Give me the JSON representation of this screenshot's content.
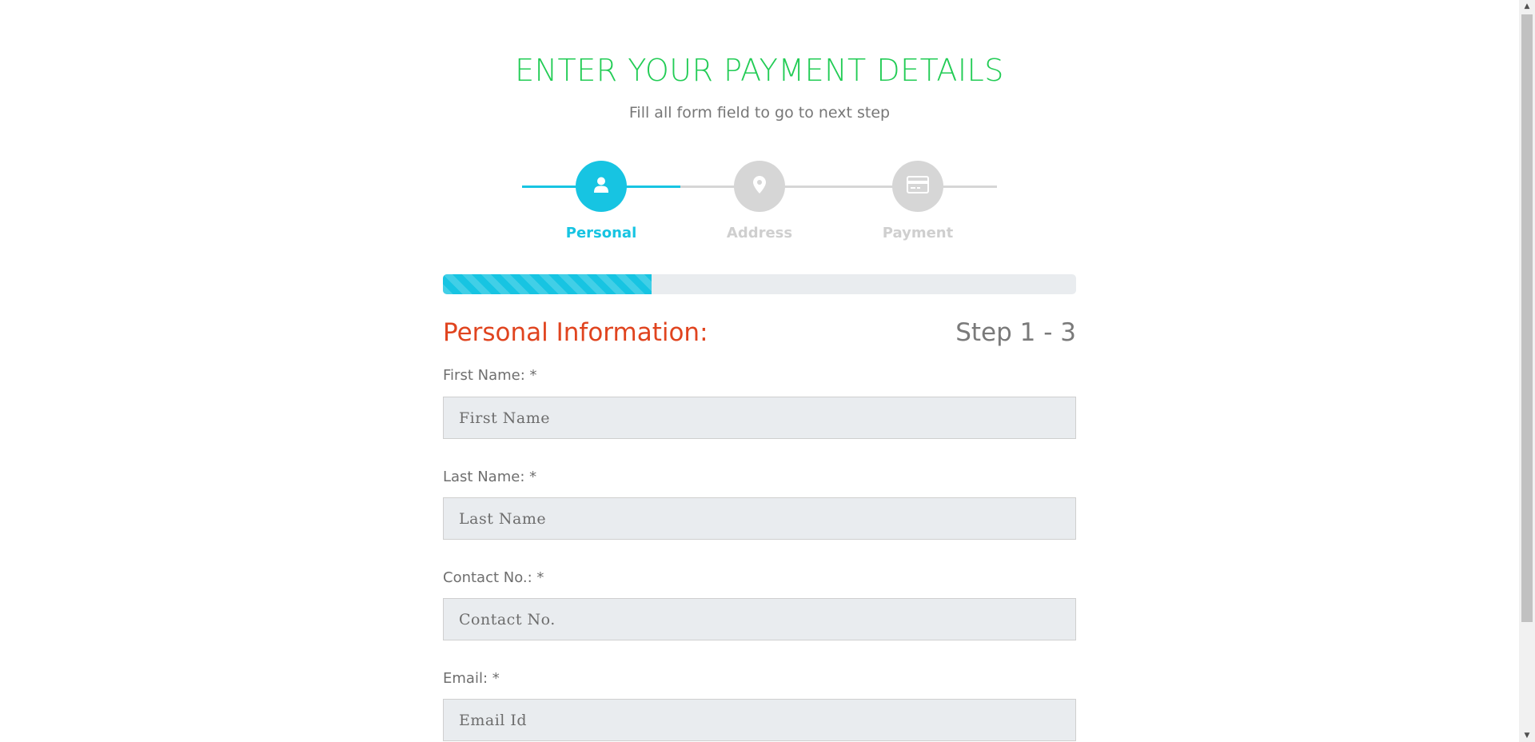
{
  "header": {
    "title": "ENTER YOUR PAYMENT DETAILS",
    "subtitle": "Fill all form field to go to next step"
  },
  "steps": [
    {
      "label": "Personal",
      "icon": "user-icon",
      "active": true
    },
    {
      "label": "Address",
      "icon": "map-pin-icon",
      "active": false
    },
    {
      "label": "Payment",
      "icon": "credit-card-icon",
      "active": false
    }
  ],
  "progress": {
    "percent": 33
  },
  "section": {
    "title": "Personal Information:",
    "step_count": "Step 1 - 3"
  },
  "fields": {
    "first_name": {
      "label": "First Name: *",
      "placeholder": "First Name"
    },
    "last_name": {
      "label": "Last Name: *",
      "placeholder": "Last Name"
    },
    "contact": {
      "label": "Contact No.: *",
      "placeholder": "Contact No."
    },
    "email": {
      "label": "Email: *",
      "placeholder": "Email Id"
    }
  },
  "colors": {
    "title": "#22cc55",
    "accent": "#17c4e2",
    "section_title": "#e0441f",
    "inactive": "#d6d6d6"
  }
}
